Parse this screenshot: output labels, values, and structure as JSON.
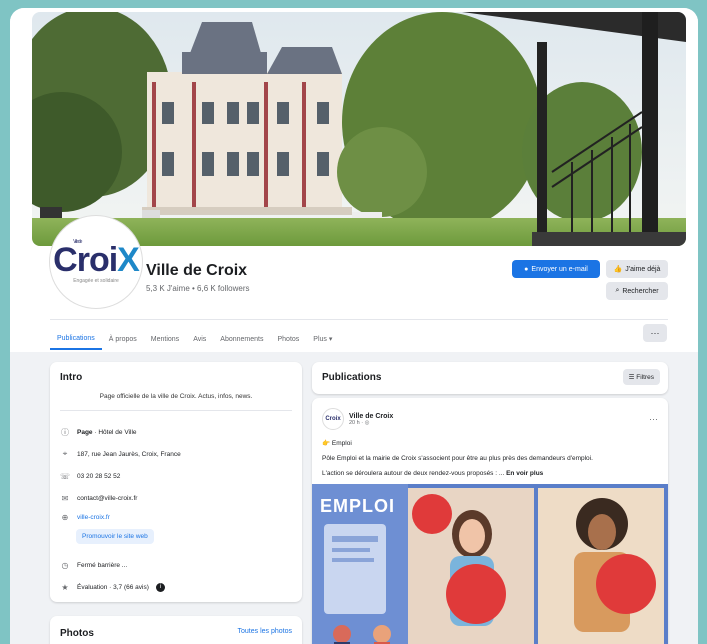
{
  "page": {
    "name": "Ville de Croix",
    "stats": "5,3 K J'aime • 6,6 K followers",
    "logo": {
      "main": "Croi",
      "x": "X",
      "small": "Ville de",
      "tagline": "Engagée et solidaire"
    }
  },
  "actions": {
    "email": "Envoyer un e-mail",
    "like": "J'aime déjà",
    "search": "Rechercher",
    "more": "···"
  },
  "tabs": [
    "Publications",
    "À propos",
    "Mentions",
    "Avis",
    "Abonnements",
    "Photos",
    "Plus ▾"
  ],
  "intro": {
    "title": "Intro",
    "description": "Page officielle de la ville de Croix. Actus, infos, news.",
    "page_type_label": "Page",
    "page_type": " · Hôtel de Ville",
    "address": "187, rue Jean Jaurès, Croix, France",
    "phone": "03 20 28 52 52",
    "email": "contact@ville-croix.fr",
    "website": "ville-croix.fr",
    "promote": "Promouvoir le site web",
    "hours": "Fermé barrière ...",
    "rating": "Évaluation · 3,7 (66 avis)"
  },
  "photos": {
    "title": "Photos",
    "see_all": "Toutes les photos"
  },
  "publications": {
    "title": "Publications",
    "filters": "Filtres"
  },
  "post": {
    "author": "Ville de Croix",
    "meta": "20 h · ◎",
    "tag": "Emploi",
    "line1": "Pôle Emploi et la mairie de Croix s'associent pour être au plus près des demandeurs d'emploi.",
    "line2": "L'action se déroulera autour de deux rendez-vous proposés : ...",
    "see_more": "En voir plus",
    "image_title": "EMPLOI",
    "mini_logo": "Croix"
  }
}
